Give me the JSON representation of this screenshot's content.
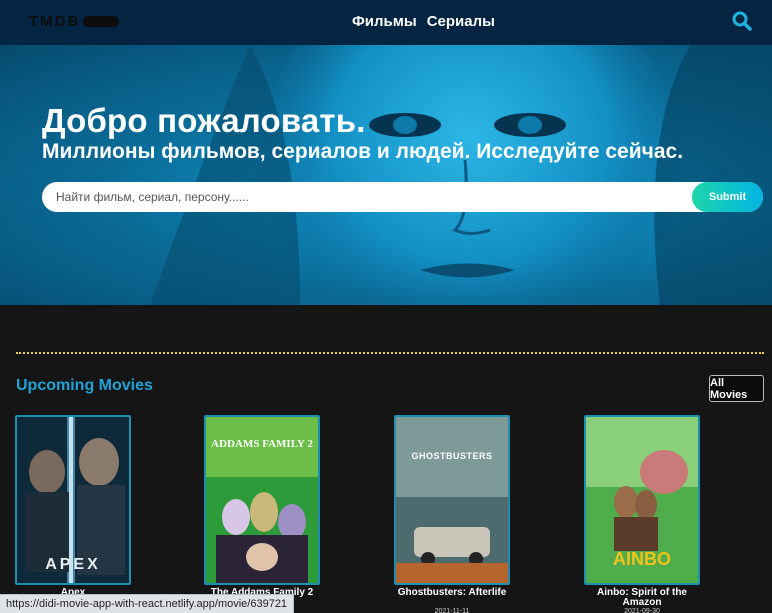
{
  "header": {
    "logo_text": "TMDB",
    "nav": [
      {
        "label": "Фильмы"
      },
      {
        "label": "Сериалы"
      }
    ],
    "search_icon": "search-icon"
  },
  "hero": {
    "title": "Добро пожаловать.",
    "subtitle": "Миллионы фильмов, сериалов и людей. Исследуйте сейчас.",
    "search_placeholder": "Найти фильм, сериал, персону......",
    "submit_label": "Submit"
  },
  "section": {
    "title": "Upcoming Movies",
    "all_label": "All Movies"
  },
  "movies": [
    {
      "title": "Apex",
      "date": ""
    },
    {
      "title": "The Addams Family 2",
      "date": ""
    },
    {
      "title": "Ghostbusters: Afterlife",
      "date": "2021-11-11"
    },
    {
      "title": "Ainbo: Spirit of the Amazon",
      "date": "2021-09-30"
    }
  ],
  "posters": [
    {
      "text": "APEX"
    },
    {
      "text": "ADDAMS FAMILY 2"
    },
    {
      "text": "GHOSTBUSTERS"
    },
    {
      "text": "AINBO"
    }
  ],
  "status_bar": {
    "url": "https://didi-movie-app-with-react.netlify.app/movie/639721"
  },
  "colors": {
    "header_bg": "#032541",
    "accent": "#01b4e4",
    "accent_green": "#1ed5a9",
    "section_title": "#1fa2d6",
    "divider": "#e8d44d"
  }
}
